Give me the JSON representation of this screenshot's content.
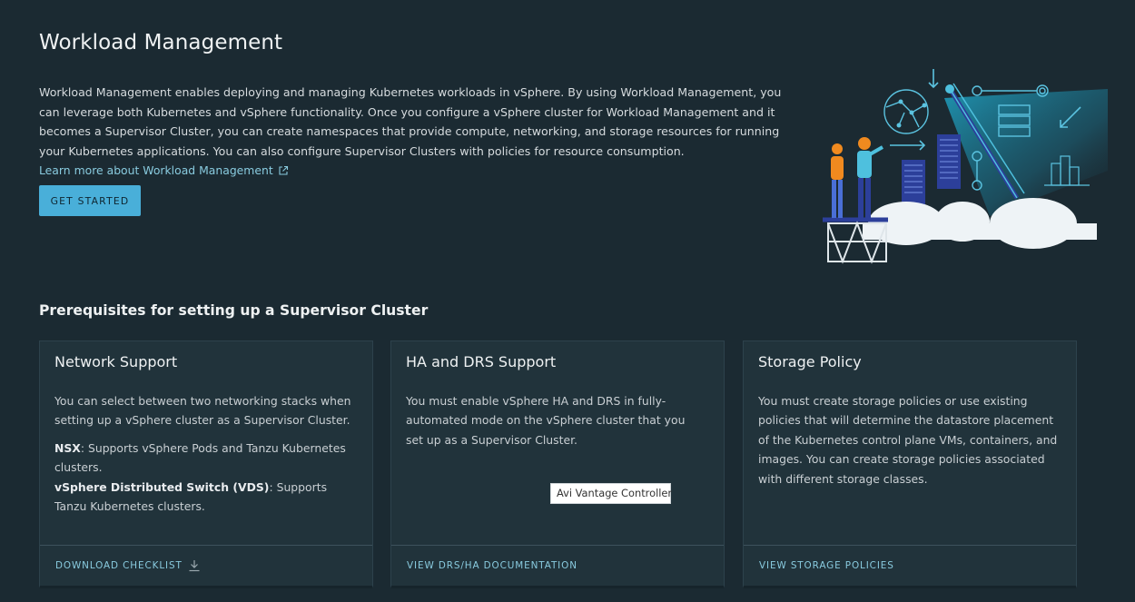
{
  "page": {
    "title": "Workload Management",
    "intro": "Workload Management enables deploying and managing Kubernetes workloads in vSphere. By using Workload Management, you can leverage both Kubernetes and vSphere functionality. Once you configure a vSphere cluster for Workload Management and it becomes a Supervisor Cluster, you can create namespaces that provide compute, networking, and storage resources for running your Kubernetes applications. You can also configure Supervisor Clusters with policies for resource consumption.",
    "learn_more": "Learn more about Workload Management",
    "get_started": "GET STARTED"
  },
  "prereq": {
    "title": "Prerequisites for setting up a Supervisor Cluster",
    "cards": [
      {
        "title": "Network Support",
        "body": "You can select between two networking stacks when setting up a vSphere cluster as a Supervisor Cluster.",
        "nsx_label": "NSX",
        "nsx_text": ": Supports vSphere Pods and Tanzu Kubernetes clusters.",
        "vds_label": "vSphere Distributed Switch (VDS)",
        "vds_text": ": Supports Tanzu Kubernetes clusters.",
        "link": "DOWNLOAD CHECKLIST"
      },
      {
        "title": "HA and DRS Support",
        "body": "You must enable vSphere HA and DRS in fully-automated mode on the vSphere cluster that you set up as a Supervisor Cluster.",
        "link": "VIEW DRS/HA DOCUMENTATION"
      },
      {
        "title": "Storage Policy",
        "body": "You must create storage policies or use existing policies that will determine the datastore placement of the Kubernetes control plane VMs, containers, and images. You can create storage policies associated with different storage classes.",
        "link": "VIEW STORAGE POLICIES"
      }
    ]
  },
  "tooltip": "Avi Vantage Controller",
  "icons": {
    "external_link": "external-link-icon",
    "download": "download-icon"
  },
  "colors": {
    "background": "#1b2a32",
    "card": "#21333b",
    "link": "#89cbdf",
    "button": "#49afd9"
  }
}
